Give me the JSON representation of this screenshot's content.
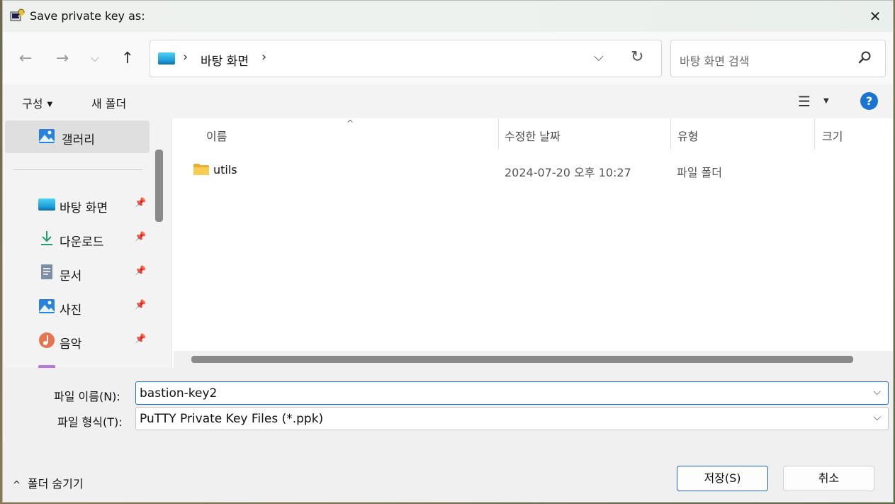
{
  "window": {
    "title": "Save private key as:",
    "close_glyph": "✕"
  },
  "nav": {
    "back_glyph": "←",
    "forward_glyph": "→",
    "recent_glyph": "⌵",
    "up_glyph": "↑",
    "address": {
      "sep1": "›",
      "crumb": "바탕 화면",
      "sep2": "›",
      "dropdown_glyph": "⌵",
      "refresh_glyph": "↻"
    },
    "search": {
      "placeholder": "바탕 화면 검색"
    }
  },
  "commandbar": {
    "organize": "구성",
    "organize_caret": "▼",
    "new_folder": "새 폴더",
    "view_glyph": "☰",
    "view_caret": "▼",
    "help": "?"
  },
  "sidebar": {
    "gallery": "갤러리",
    "items": [
      {
        "label": "바탕 화면",
        "icon": "desktop-icon",
        "pin": "📌"
      },
      {
        "label": "다운로드",
        "icon": "download-icon",
        "pin": "📌"
      },
      {
        "label": "문서",
        "icon": "document-icon",
        "pin": "📌"
      },
      {
        "label": "사진",
        "icon": "pictures-icon",
        "pin": "📌"
      },
      {
        "label": "음악",
        "icon": "music-icon",
        "pin": "📌"
      }
    ]
  },
  "filelist": {
    "columns": {
      "name": "이름",
      "modified": "수정한 날짜",
      "type": "유형",
      "size": "크기"
    },
    "sort_glyph": "^",
    "rows": [
      {
        "name": "utils",
        "modified": "2024-07-20 오후 10:27",
        "type": "파일 폴더"
      }
    ]
  },
  "form": {
    "filename_label": "파일 이름(N):",
    "filename_value": "bastion-key2",
    "filetype_label": "파일 형식(T):",
    "filetype_value": "PuTTY Private Key Files (*.ppk)",
    "chevron": "⌵"
  },
  "footer": {
    "hide_folders": "폴더 숨기기",
    "hide_glyph": "^",
    "save": "저장(S)",
    "cancel": "취소"
  },
  "colors": {
    "accent": "#1a73c9",
    "help_blue": "#1a75d2",
    "folder_yellow": "#f4c542"
  }
}
